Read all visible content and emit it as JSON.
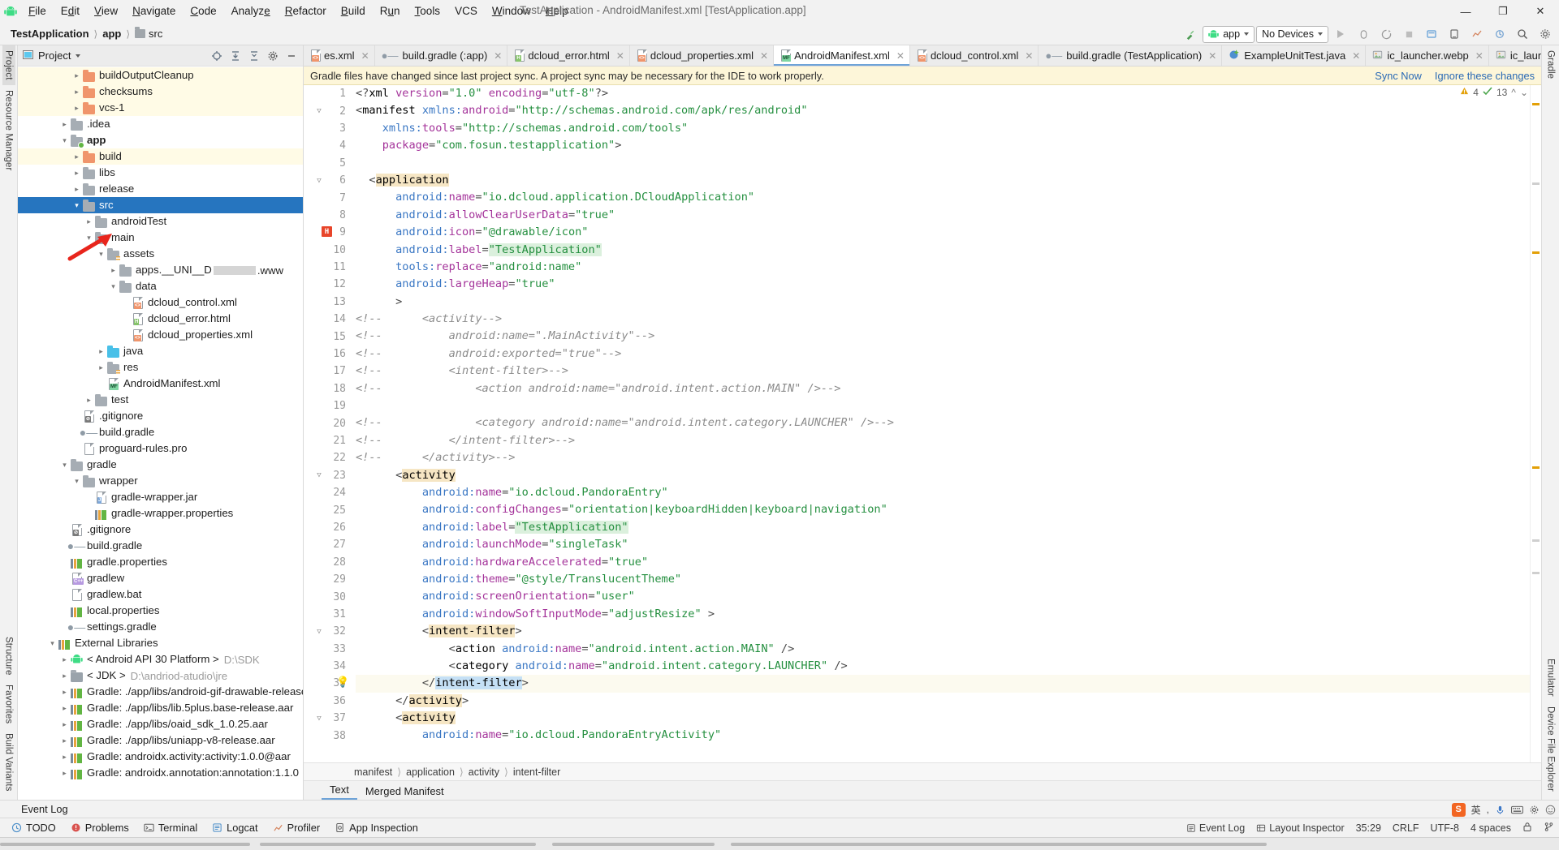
{
  "window": {
    "title": "TestApplication - AndroidManifest.xml [TestApplication.app]",
    "minimize": "—",
    "maximize": "❐",
    "close": "✕"
  },
  "menu": [
    {
      "label": "File"
    },
    {
      "label": "Edit"
    },
    {
      "label": "View"
    },
    {
      "label": "Navigate"
    },
    {
      "label": "Code"
    },
    {
      "label": "Analyze"
    },
    {
      "label": "Refactor"
    },
    {
      "label": "Build"
    },
    {
      "label": "Run"
    },
    {
      "label": "Tools"
    },
    {
      "label": "VCS"
    },
    {
      "label": "Window"
    },
    {
      "label": "Help"
    }
  ],
  "breadcrumb": [
    {
      "label": "TestApplication",
      "bold": true
    },
    {
      "label": "app",
      "bold": true
    },
    {
      "label": "src",
      "bold": false
    }
  ],
  "toolbar": {
    "run_config": "app",
    "device": "No Devices",
    "run_tooltip": "Run",
    "search_icon": "search-icon",
    "hammer_icon": "build-icon"
  },
  "project_panel": {
    "title": "Project",
    "tree": [
      {
        "depth": 4,
        "twisty": ">",
        "icon": "folder-orange",
        "label": "buildOutputCleanup",
        "hl": true
      },
      {
        "depth": 4,
        "twisty": ">",
        "icon": "folder-orange",
        "label": "checksums",
        "hl": true
      },
      {
        "depth": 4,
        "twisty": ">",
        "icon": "folder-orange",
        "label": "vcs-1",
        "hl": true
      },
      {
        "depth": 3,
        "twisty": ">",
        "icon": "folder-grey",
        "label": ".idea"
      },
      {
        "depth": 3,
        "twisty": "v",
        "icon": "folder-module",
        "label": "app",
        "bold": true
      },
      {
        "depth": 4,
        "twisty": ">",
        "icon": "folder-orange",
        "label": "build",
        "hl": true
      },
      {
        "depth": 4,
        "twisty": ">",
        "icon": "folder-grey",
        "label": "libs"
      },
      {
        "depth": 4,
        "twisty": ">",
        "icon": "folder-grey",
        "label": "release"
      },
      {
        "depth": 4,
        "twisty": "v",
        "icon": "folder-grey",
        "label": "src",
        "selected": true
      },
      {
        "depth": 5,
        "twisty": ">",
        "icon": "folder-grey",
        "label": "androidTest"
      },
      {
        "depth": 5,
        "twisty": "v",
        "icon": "folder-grey",
        "label": "main"
      },
      {
        "depth": 6,
        "twisty": "v",
        "icon": "folder-src",
        "label": "assets"
      },
      {
        "depth": 7,
        "twisty": ">",
        "icon": "folder-grey",
        "label": "apps.__UNI__D",
        "redacted": true,
        "suffix": ".www"
      },
      {
        "depth": 7,
        "twisty": "v",
        "icon": "folder-grey",
        "label": "data"
      },
      {
        "depth": 8,
        "twisty": "",
        "icon": "file-xml",
        "label": "dcloud_control.xml"
      },
      {
        "depth": 8,
        "twisty": "",
        "icon": "file-html",
        "label": "dcloud_error.html"
      },
      {
        "depth": 8,
        "twisty": "",
        "icon": "file-xml",
        "label": "dcloud_properties.xml"
      },
      {
        "depth": 6,
        "twisty": ">",
        "icon": "folder-java",
        "label": "java"
      },
      {
        "depth": 6,
        "twisty": ">",
        "icon": "folder-res",
        "label": "res"
      },
      {
        "depth": 6,
        "twisty": "",
        "icon": "file-mf",
        "label": "AndroidManifest.xml"
      },
      {
        "depth": 5,
        "twisty": ">",
        "icon": "folder-grey",
        "label": "test"
      },
      {
        "depth": 4,
        "twisty": "",
        "icon": "file-gitignore",
        "label": ".gitignore"
      },
      {
        "depth": 4,
        "twisty": "",
        "icon": "file-gradle",
        "label": "build.gradle"
      },
      {
        "depth": 4,
        "twisty": "",
        "icon": "file-text",
        "label": "proguard-rules.pro"
      },
      {
        "depth": 3,
        "twisty": "v",
        "icon": "folder-grey",
        "label": "gradle"
      },
      {
        "depth": 4,
        "twisty": "v",
        "icon": "folder-grey",
        "label": "wrapper"
      },
      {
        "depth": 5,
        "twisty": "",
        "icon": "file-jar",
        "label": "gradle-wrapper.jar"
      },
      {
        "depth": 5,
        "twisty": "",
        "icon": "file-props",
        "label": "gradle-wrapper.properties"
      },
      {
        "depth": 3,
        "twisty": "",
        "icon": "file-gitignore",
        "label": ".gitignore"
      },
      {
        "depth": 3,
        "twisty": "",
        "icon": "file-gradle",
        "label": "build.gradle"
      },
      {
        "depth": 3,
        "twisty": "",
        "icon": "file-props",
        "label": "gradle.properties"
      },
      {
        "depth": 3,
        "twisty": "",
        "icon": "file-cpp",
        "label": "gradlew"
      },
      {
        "depth": 3,
        "twisty": "",
        "icon": "file-text",
        "label": "gradlew.bat"
      },
      {
        "depth": 3,
        "twisty": "",
        "icon": "file-props",
        "label": "local.properties"
      },
      {
        "depth": 3,
        "twisty": "",
        "icon": "file-gradle",
        "label": "settings.gradle"
      },
      {
        "depth": 2,
        "twisty": "v",
        "icon": "libs-icon",
        "label": "External Libraries"
      },
      {
        "depth": 3,
        "twisty": ">",
        "icon": "android-icon",
        "label": "< Android API 30 Platform >",
        "sub": "D:\\SDK"
      },
      {
        "depth": 3,
        "twisty": ">",
        "icon": "jdk-icon",
        "label": "< JDK >",
        "sub": "D:\\andriod-atudio\\jre"
      },
      {
        "depth": 3,
        "twisty": ">",
        "icon": "file-props",
        "label": "Gradle: ./app/libs/android-gif-drawable-release@"
      },
      {
        "depth": 3,
        "twisty": ">",
        "icon": "file-props",
        "label": "Gradle: ./app/libs/lib.5plus.base-release.aar"
      },
      {
        "depth": 3,
        "twisty": ">",
        "icon": "file-props",
        "label": "Gradle: ./app/libs/oaid_sdk_1.0.25.aar"
      },
      {
        "depth": 3,
        "twisty": ">",
        "icon": "file-props",
        "label": "Gradle: ./app/libs/uniapp-v8-release.aar"
      },
      {
        "depth": 3,
        "twisty": ">",
        "icon": "file-props",
        "label": "Gradle: androidx.activity:activity:1.0.0@aar"
      },
      {
        "depth": 3,
        "twisty": ">",
        "icon": "file-props",
        "label": "Gradle: androidx.annotation:annotation:1.1.0"
      }
    ]
  },
  "left_rail": {
    "top": [
      "Project",
      "Resource Manager"
    ],
    "bottom": [
      "Structure",
      "Favorites",
      "Build Variants"
    ]
  },
  "right_rail": {
    "top": [
      "Gradle"
    ],
    "bottom": [
      "Emulator",
      "Device File Explorer"
    ]
  },
  "editor_tabs": [
    {
      "label": "es.xml",
      "icon": "xml-file-icon",
      "active": false
    },
    {
      "label": "build.gradle (:app)",
      "icon": "gradle-file-icon",
      "active": false
    },
    {
      "label": "dcloud_error.html",
      "icon": "html-file-icon",
      "active": false
    },
    {
      "label": "dcloud_properties.xml",
      "icon": "xml-file-icon",
      "active": false
    },
    {
      "label": "AndroidManifest.xml",
      "icon": "manifest-file-icon",
      "active": true
    },
    {
      "label": "dcloud_control.xml",
      "icon": "xml-file-icon",
      "active": false
    },
    {
      "label": "build.gradle (TestApplication)",
      "icon": "gradle-file-icon",
      "active": false
    },
    {
      "label": "ExampleUnitTest.java",
      "icon": "java-test-file-icon",
      "active": false
    },
    {
      "label": "ic_launcher.webp",
      "icon": "image-file-icon",
      "active": false
    },
    {
      "label": "ic_launch",
      "icon": "image-file-icon",
      "active": false
    }
  ],
  "notification": {
    "message": "Gradle files have changed since last project sync. A project sync may be necessary for the IDE to work properly.",
    "sync_now": "Sync Now",
    "ignore": "Ignore these changes"
  },
  "inspections": {
    "warning_count": "4",
    "ok_count": "13",
    "warning_icon": "warning-triangle-icon",
    "ok_icon": "checkmark-icon"
  },
  "code": {
    "filename": "AndroidManifest.xml",
    "first_line": 1,
    "lines": [
      {
        "n": 1,
        "text": "<?xml version=\"1.0\" encoding=\"utf-8\"?>"
      },
      {
        "n": 2,
        "text": "<manifest xmlns:android=\"http://schemas.android.com/apk/res/android\"",
        "fold": "-"
      },
      {
        "n": 3,
        "text": "    xmlns:tools=\"http://schemas.android.com/tools\""
      },
      {
        "n": 4,
        "text": "    package=\"com.fosun.testapplication\">"
      },
      {
        "n": 5,
        "text": ""
      },
      {
        "n": 6,
        "text": "  <application",
        "fold": "-"
      },
      {
        "n": 7,
        "text": "      android:name=\"io.dcloud.application.DCloudApplication\""
      },
      {
        "n": 8,
        "text": "      android:allowClearUserData=\"true\""
      },
      {
        "n": 9,
        "text": "      android:icon=\"@drawable/icon\"",
        "marker": "bookmark-h"
      },
      {
        "n": 10,
        "text": "      android:label=\"TestApplication\""
      },
      {
        "n": 11,
        "text": "      tools:replace=\"android:name\""
      },
      {
        "n": 12,
        "text": "      android:largeHeap=\"true\""
      },
      {
        "n": 13,
        "text": "      >"
      },
      {
        "n": 14,
        "text": "<!--      <activity-->"
      },
      {
        "n": 15,
        "text": "<!--          android:name=\".MainActivity\"-->"
      },
      {
        "n": 16,
        "text": "<!--          android:exported=\"true\"-->"
      },
      {
        "n": 17,
        "text": "<!--          <intent-filter>-->"
      },
      {
        "n": 18,
        "text": "<!--              <action android:name=\"android.intent.action.MAIN\" />-->"
      },
      {
        "n": 19,
        "text": ""
      },
      {
        "n": 20,
        "text": "<!--              <category android:name=\"android.intent.category.LAUNCHER\" />-->"
      },
      {
        "n": 21,
        "text": "<!--          </intent-filter>-->"
      },
      {
        "n": 22,
        "text": "<!--      </activity>-->"
      },
      {
        "n": 23,
        "text": "      <activity",
        "fold": "-"
      },
      {
        "n": 24,
        "text": "          android:name=\"io.dcloud.PandoraEntry\""
      },
      {
        "n": 25,
        "text": "          android:configChanges=\"orientation|keyboardHidden|keyboard|navigation\""
      },
      {
        "n": 26,
        "text": "          android:label=\"TestApplication\""
      },
      {
        "n": 27,
        "text": "          android:launchMode=\"singleTask\""
      },
      {
        "n": 28,
        "text": "          android:hardwareAccelerated=\"true\""
      },
      {
        "n": 29,
        "text": "          android:theme=\"@style/TranslucentTheme\""
      },
      {
        "n": 30,
        "text": "          android:screenOrientation=\"user\""
      },
      {
        "n": 31,
        "text": "          android:windowSoftInputMode=\"adjustResize\" >"
      },
      {
        "n": 32,
        "text": "          <intent-filter>",
        "fold": "-"
      },
      {
        "n": 33,
        "text": "              <action android:name=\"android.intent.action.MAIN\" />"
      },
      {
        "n": 34,
        "text": "              <category android:name=\"android.intent.category.LAUNCHER\" />"
      },
      {
        "n": 35,
        "text": "          </intent-filter>",
        "current": true,
        "gutter_icon": "lightbulb-icon"
      },
      {
        "n": 36,
        "text": "      </activity>"
      },
      {
        "n": 37,
        "text": "      <activity",
        "fold": "-"
      },
      {
        "n": 38,
        "text": "          android:name=\"io.dcloud.PandoraEntryActivity\""
      }
    ]
  },
  "code_breadcrumbs": [
    "manifest",
    "application",
    "activity",
    "intent-filter"
  ],
  "view_tabs": [
    {
      "label": "Text",
      "active": true
    },
    {
      "label": "Merged Manifest",
      "active": false
    }
  ],
  "event_log_strip": {
    "label": "Event Log"
  },
  "bottom_tools": [
    {
      "label": "TODO",
      "icon": "todo-icon"
    },
    {
      "label": "Problems",
      "icon": "problems-icon"
    },
    {
      "label": "Terminal",
      "icon": "terminal-icon"
    },
    {
      "label": "Logcat",
      "icon": "logcat-icon"
    },
    {
      "label": "Profiler",
      "icon": "profiler-icon"
    },
    {
      "label": "App Inspection",
      "icon": "app-inspection-icon"
    }
  ],
  "status_bar": {
    "event_log": "Event Log",
    "layout_inspector": "Layout Inspector",
    "caret": "35:29",
    "line_sep": "CRLF",
    "encoding": "UTF-8",
    "indent": "4 spaces",
    "lock_icon": "lock-icon",
    "branch_icon": "git-branch-icon"
  },
  "ime_tray": {
    "lang": "英",
    "items": [
      "sogou-icon",
      "keyboard-icon",
      "mic-icon",
      "settings-icon",
      "emoji-icon"
    ]
  },
  "colors": {
    "accent_blue": "#2675bf",
    "tab_underline": "#6ea3d8",
    "notification_bg": "#fdf6d9",
    "link": "#2a6ab5",
    "folder_orange": "#f0956c",
    "folder_grey": "#a6adb4",
    "string_green": "#248f3f",
    "attr_purple": "#a4339a",
    "comment_grey": "#8c8c8c",
    "ns_blue": "#3a77c4",
    "current_line": "#fcfaef",
    "red_arrow": "#e8251c"
  }
}
